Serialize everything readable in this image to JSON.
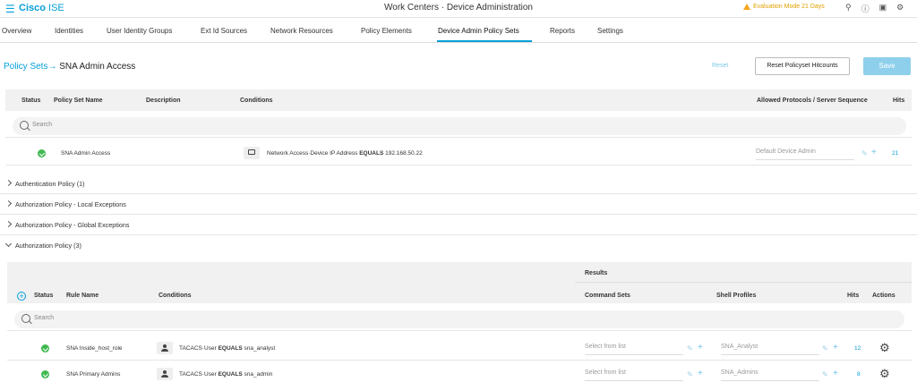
{
  "header": {
    "brand_company": "Cisco",
    "brand_product": "ISE",
    "title": "Work Centers · Device Administration",
    "evaluation": "Evaluation Mode 21 Days",
    "icons": [
      "search-icon",
      "help-icon",
      "dashboard-icon",
      "settings-icon"
    ]
  },
  "nav": {
    "tabs": [
      {
        "label": "Overview"
      },
      {
        "label": "Identities"
      },
      {
        "label": "User Identity Groups"
      },
      {
        "label": "Ext Id Sources"
      },
      {
        "label": "Network Resources"
      },
      {
        "label": "Policy Elements"
      },
      {
        "label": "Device Admin Policy Sets"
      },
      {
        "label": "Reports"
      },
      {
        "label": "Settings"
      }
    ],
    "active": "Device Admin Policy Sets"
  },
  "breadcrumb": {
    "root": "Policy Sets",
    "arrow": "→",
    "current": "SNA Admin Access"
  },
  "actions": {
    "reset": "Reset",
    "reset_hitcounts": "Reset Policyset Hitcounts",
    "save": "Save"
  },
  "policy_table": {
    "headers": {
      "status": "Status",
      "name": "Policy Set Name",
      "description": "Description",
      "conditions": "Conditions",
      "protocols": "Allowed Protocols / Server Sequence",
      "hits": "Hits"
    },
    "search_placeholder": "Search",
    "row": {
      "name": "SNA Admin Access",
      "condition_attr": "Network Access·Device IP Address",
      "condition_op": "EQUALS",
      "condition_value": "192.168.50.22",
      "protocol": "Default Device Admin",
      "hits": "21"
    }
  },
  "sections": {
    "authentication": "Authentication Policy (1)",
    "local_exceptions": "Authorization Policy - Local Exceptions",
    "global_exceptions": "Authorization Policy - Global Exceptions",
    "authorization": "Authorization Policy (3)"
  },
  "auth_table": {
    "headers": {
      "results": "Results",
      "status": "Status",
      "rule_name": "Rule Name",
      "conditions": "Conditions",
      "command_sets": "Command Sets",
      "shell_profiles": "Shell Profiles",
      "hits": "Hits",
      "actions": "Actions"
    },
    "search_placeholder": "Search",
    "rows": [
      {
        "name": "SNA Inside_host_role",
        "cond_attr": "TACACS·User",
        "cond_op": "EQUALS",
        "cond_value": "sna_analyst",
        "command_set": "Select from list",
        "shell_profile": "SNA_Analyst",
        "hits": "12"
      },
      {
        "name": "SNA Primary Admins",
        "cond_attr": "TACACS·User",
        "cond_op": "EQUALS",
        "cond_value": "sna_admin",
        "command_set": "Select from list",
        "shell_profile": "SNA_Admins",
        "hits": "8"
      }
    ]
  }
}
